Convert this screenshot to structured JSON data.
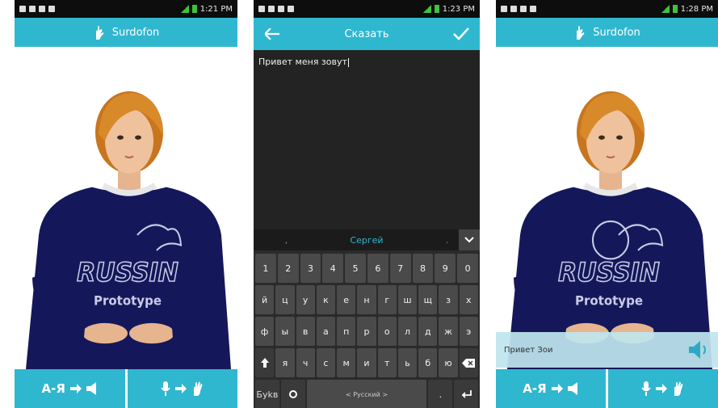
{
  "status_bars": [
    {
      "time": "1:21 PM"
    },
    {
      "time": "1:23 PM"
    },
    {
      "time": "1:28 PM"
    }
  ],
  "screens": {
    "left": {
      "app_title": "Surdofon",
      "shirt_text_main": "RUSSIN",
      "shirt_text_sub": "Prototype",
      "bottom_left_label": "А-Я",
      "colors": {
        "accent": "#2fb7cf",
        "shirt": "#14185a"
      }
    },
    "middle": {
      "title": "Сказать",
      "input_text": "Привет меня зовут",
      "suggestions": [
        ",",
        "Сергей",
        "."
      ],
      "keyboard": {
        "row_numbers": [
          "1",
          "2",
          "3",
          "4",
          "5",
          "6",
          "7",
          "8",
          "9",
          "0"
        ],
        "row1": [
          "й",
          "ц",
          "у",
          "к",
          "е",
          "н",
          "г",
          "ш",
          "щ",
          "з",
          "х"
        ],
        "row2": [
          "ф",
          "ы",
          "в",
          "а",
          "п",
          "р",
          "о",
          "л",
          "д",
          "ж",
          "э"
        ],
        "row3": [
          "я",
          "ч",
          "с",
          "м",
          "и",
          "т",
          "ь",
          "б",
          "ю"
        ],
        "lang_key": "Буkв",
        "space_label": "< Русский >"
      }
    },
    "right": {
      "app_title": "Surdofon",
      "shirt_text_main": "RUSSIN",
      "shirt_text_sub": "Prototype",
      "banner_text": "Привет Зои",
      "bottom_left_label": "А-Я"
    }
  }
}
